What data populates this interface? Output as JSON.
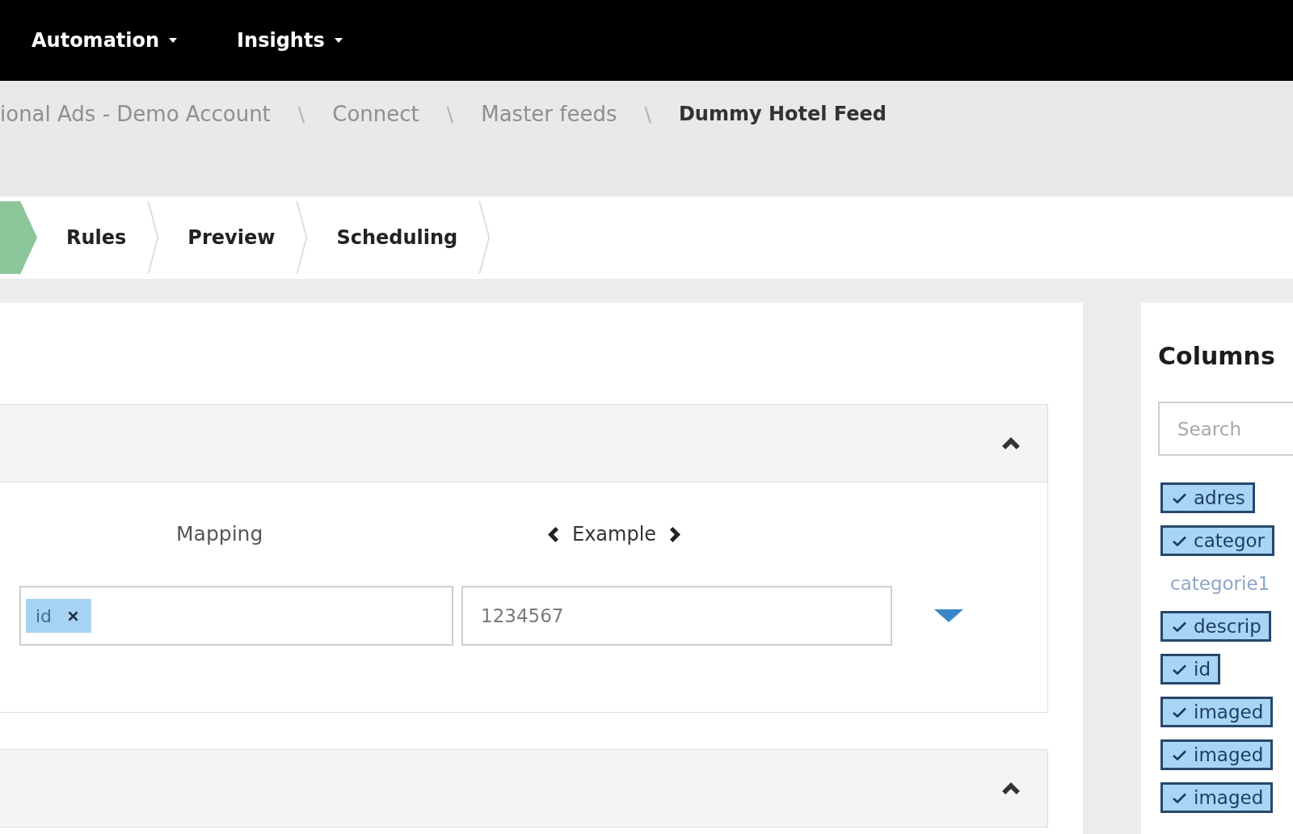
{
  "top_nav": {
    "items": [
      {
        "label": "Automation"
      },
      {
        "label": "Insights"
      }
    ]
  },
  "breadcrumb": {
    "items": [
      {
        "kind": "link",
        "label": "ional Ads - Demo Account"
      },
      {
        "kind": "separator",
        "label": "\\"
      },
      {
        "kind": "link",
        "label": "Connect"
      },
      {
        "kind": "separator",
        "label": "\\"
      },
      {
        "kind": "link",
        "label": "Master feeds"
      },
      {
        "kind": "separator",
        "label": "\\"
      },
      {
        "kind": "current",
        "label": "Dummy Hotel Feed"
      }
    ]
  },
  "steps": [
    {
      "selected": true
    },
    {
      "label": "Rules",
      "selected": false
    },
    {
      "label": "Preview",
      "selected": false
    },
    {
      "label": "Scheduling",
      "selected": false
    }
  ],
  "mapping_panel": {
    "sections": [
      {
        "expanded": true,
        "mapping_label": "Mapping",
        "example_label": "Example",
        "mapping_tags": [
          {
            "label": "id"
          }
        ],
        "example_value": "1234567"
      },
      {
        "expanded": true
      }
    ]
  },
  "columns_panel": {
    "title": "Columns",
    "search": {
      "placeholder": "Search"
    },
    "items": [
      {
        "label": "adres",
        "selected": true
      },
      {
        "label": "categor",
        "selected": true
      },
      {
        "label": "categorie1",
        "selected": false
      },
      {
        "label": "descrip",
        "selected": true
      },
      {
        "label": "id",
        "selected": true
      },
      {
        "label": "imaged",
        "selected": true
      },
      {
        "label": "imaged",
        "selected": true
      },
      {
        "label": "imaged",
        "selected": true
      }
    ]
  }
}
